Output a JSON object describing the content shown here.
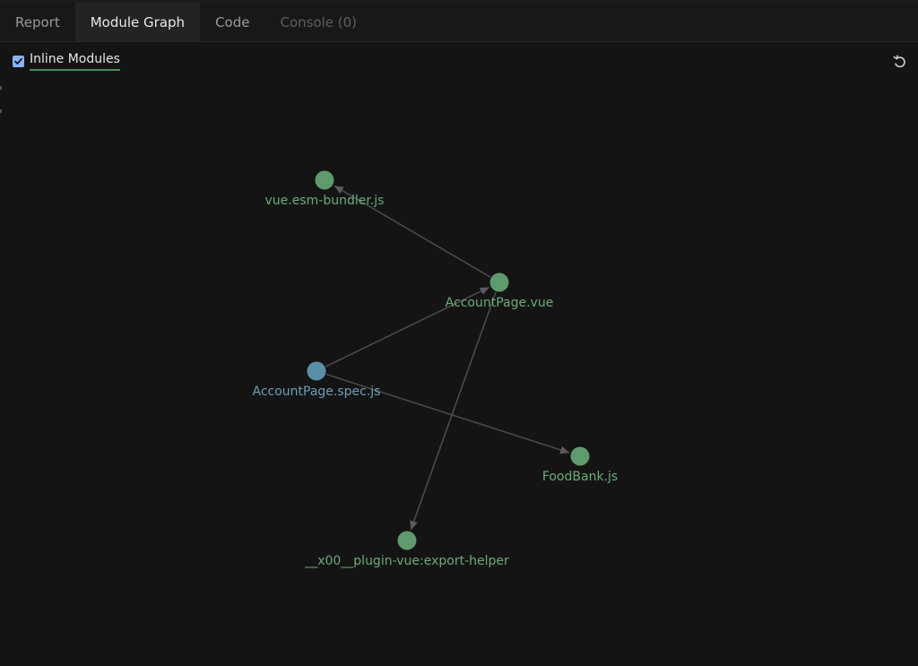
{
  "tabs": [
    {
      "label": "Report",
      "state": "normal"
    },
    {
      "label": "Module Graph",
      "state": "active"
    },
    {
      "label": "Code",
      "state": "normal"
    },
    {
      "label": "Console (0)",
      "state": "disabled"
    }
  ],
  "toolbar": {
    "inline_modules_label": "Inline Modules",
    "inline_modules_checked": true,
    "reset_icon": "undo-icon"
  },
  "colors": {
    "background": "#141414",
    "module_node": "#5f9a6c",
    "test_node": "#5a8fa8",
    "module_label": "#6aab78",
    "test_label": "#6d9fb9",
    "edge": "#4a4a4a",
    "checkbox": "#8ab4f8"
  },
  "graph": {
    "nodes": [
      {
        "id": "vue",
        "label": "vue.esm-bundler.js",
        "kind": "module"
      },
      {
        "id": "account",
        "label": "AccountPage.vue",
        "kind": "module"
      },
      {
        "id": "spec",
        "label": "AccountPage.spec.js",
        "kind": "test"
      },
      {
        "id": "food",
        "label": "FoodBank.js",
        "kind": "module"
      },
      {
        "id": "helper",
        "label": "__x00__plugin-vue:export-helper",
        "kind": "module"
      }
    ],
    "edges": [
      {
        "from": "account",
        "to": "vue"
      },
      {
        "from": "spec",
        "to": "account"
      },
      {
        "from": "spec",
        "to": "food"
      },
      {
        "from": "account",
        "to": "helper"
      }
    ]
  }
}
